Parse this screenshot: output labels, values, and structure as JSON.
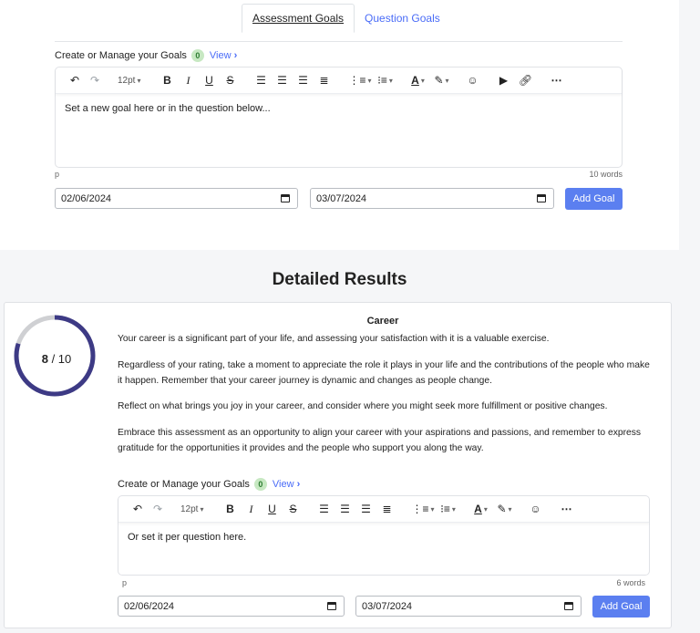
{
  "tabs": [
    {
      "label": "Assessment Goals",
      "active": true
    },
    {
      "label": "Question Goals",
      "active": false
    }
  ],
  "assessment_goals": {
    "label": "Create or Manage your Goals",
    "count": "0",
    "view_label": "View",
    "font_size": "12pt",
    "content": "Set a new goal here or in the question below...",
    "element_path": "p",
    "word_count": "10 words",
    "start_date": "02/06/2024",
    "end_date": "03/07/2024",
    "add_button": "Add Goal"
  },
  "section_title": "Detailed Results",
  "result": {
    "score": "8",
    "score_suffix": " / 10",
    "score_value": 8,
    "score_max": 10,
    "category": "Career",
    "paragraphs": [
      "Your career is a significant part of your life, and assessing your satisfaction with it is a valuable exercise.",
      "Regardless of your rating, take a moment to appreciate the role it plays in your life and the contributions of the people who make it happen. Remember that your career journey is dynamic and changes as people change.",
      "Reflect on what brings you joy in your career, and consider where you might seek more fulfillment or positive changes.",
      "Embrace this assessment as an opportunity to align your career with your aspirations and passions, and remember to express gratitude for the opportunities it provides and the people who support you along the way."
    ],
    "goals": {
      "label": "Create or Manage your Goals",
      "count": "0",
      "view_label": "View",
      "font_size": "12pt",
      "content": "Or set it per question here.",
      "element_path": "p",
      "word_count": "6 words",
      "start_date": "02/06/2024",
      "end_date": "03/07/2024",
      "add_button": "Add Goal"
    }
  },
  "colors": {
    "accent": "#5b7ff0",
    "link": "#4a6cf7",
    "ring": "#3d3a85",
    "ring_track": "#cfd0d3",
    "badge_bg": "#c7e8c2"
  }
}
